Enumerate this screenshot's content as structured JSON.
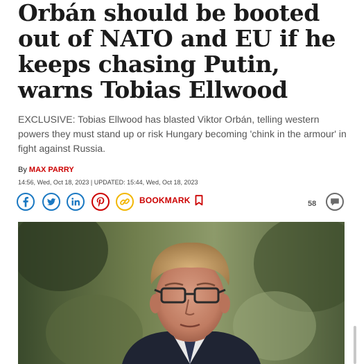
{
  "article": {
    "headline": "Orbán should be booted out of NATO and EU if he keeps chasing Putin, warns Tobias Ellwood",
    "standfirst": "EXCLUSIVE: Tobias Ellwood has blasted Viktor Orbán, telling western powers they must stand up or risk Hungary becoming 'chink in the armour' in fight against Russia.",
    "byline_prefix": "By",
    "author": "MAX PARRY",
    "dates": "14:56, Wed, Oct 18, 2023 | UPDATED: 15:44, Wed, Oct 18, 2023"
  },
  "share": {
    "icons": [
      "facebook-icon",
      "twitter-icon",
      "linkedin-icon",
      "pinterest-icon",
      "link-icon"
    ],
    "bookmark_label": "BOOKMARK",
    "comment_count": "58"
  },
  "colors": {
    "social_blue": "#1a78c2",
    "pinterest_red": "#cc0000",
    "link_yellow": "#f2b705",
    "accent_red": "#cc0000",
    "comment_grey": "#6b6b6b"
  }
}
